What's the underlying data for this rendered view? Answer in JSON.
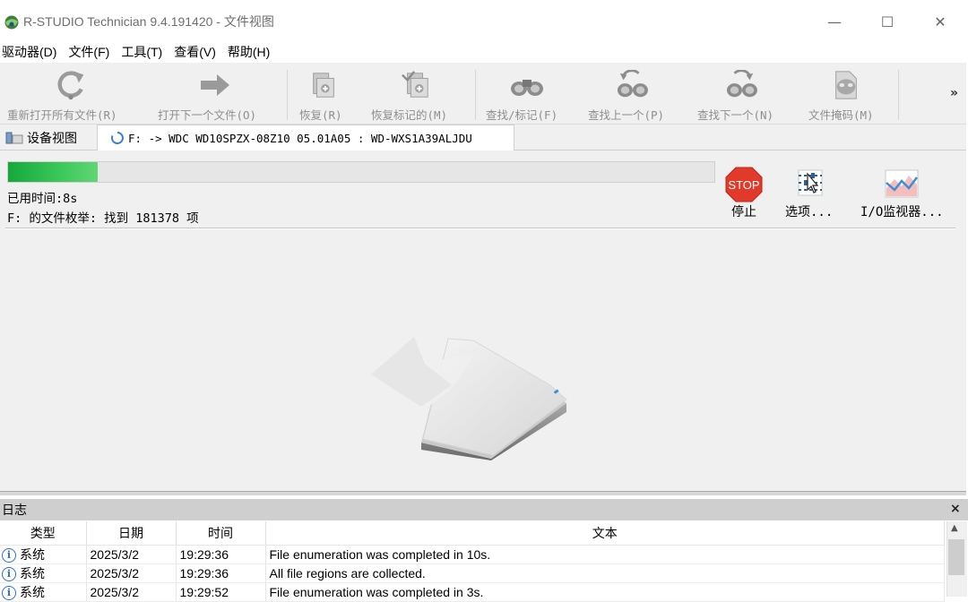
{
  "window": {
    "title": "R-STUDIO Technician 9.4.191420 - 文件视图",
    "minimize": "—",
    "maximize": "☐",
    "close": "✕"
  },
  "menu": [
    "驱动器(D)",
    "文件(F)",
    "工具(T)",
    "查看(V)",
    "帮助(H)"
  ],
  "toolbar": {
    "buttons": [
      {
        "label": "重新打开所有文件(R)",
        "icon": "reopen-icon"
      },
      {
        "label": "打开下一个文件(O)",
        "icon": "arrow-right-icon"
      },
      {
        "label": "恢复(R)",
        "icon": "recover-icon"
      },
      {
        "label": "恢复标记的(M)",
        "icon": "recover-marked-icon"
      },
      {
        "label": "查找/标记(F)",
        "icon": "binoculars-icon"
      },
      {
        "label": "查找上一个(P)",
        "icon": "find-previous-icon"
      },
      {
        "label": "查找下一个(N)",
        "icon": "find-next-icon"
      },
      {
        "label": "文件掩码(M)",
        "icon": "file-mask-icon"
      }
    ],
    "more": "»"
  },
  "tabs": {
    "device_view": "设备视图",
    "file_tab": "F: -> WDC WD10SPZX-08Z10 05.01A05 : WD-WXS1A39ALJDU"
  },
  "progress": {
    "fraction": 0.127,
    "elapsed": "已用时间:8s",
    "enumeration": "F: 的文件枚举: 找到 181378 项",
    "stop_badge": "STOP",
    "stop_label": "停止",
    "options_label": "选项...",
    "io_monitor_label": "I/O监视器..."
  },
  "log": {
    "title": "日志",
    "close": "×",
    "columns": [
      "类型",
      "日期",
      "时间",
      "文本"
    ],
    "rows": [
      {
        "type": "系统",
        "date": "2025/3/2",
        "time": "19:29:36",
        "text": "File enumeration was completed in 10s."
      },
      {
        "type": "系统",
        "date": "2025/3/2",
        "time": "19:29:36",
        "text": "All file regions are collected."
      },
      {
        "type": "系统",
        "date": "2025/3/2",
        "time": "19:29:52",
        "text": "File enumeration was completed in 3s."
      }
    ]
  },
  "colors": {
    "progress_green": "#2eb84c",
    "stop_red": "#e23a2a",
    "info_blue": "#2f6fc7"
  }
}
